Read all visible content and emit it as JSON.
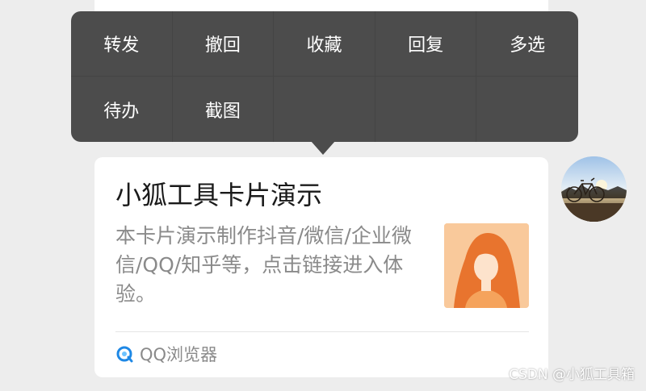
{
  "context_menu": {
    "items": [
      {
        "label": "转发"
      },
      {
        "label": "撤回"
      },
      {
        "label": "收藏"
      },
      {
        "label": "回复"
      },
      {
        "label": "多选"
      },
      {
        "label": "待办"
      },
      {
        "label": "截图"
      },
      {
        "label": ""
      },
      {
        "label": ""
      },
      {
        "label": ""
      }
    ]
  },
  "card": {
    "title": "小狐工具卡片演示",
    "description": "本卡片演示制作抖音/微信/企业微信/QQ/知乎等，点击链接进入体验。",
    "source": "QQ浏览器",
    "source_icon": "qq-browser-icon",
    "thumbnail_icon": "female-avatar-illustration"
  },
  "sender": {
    "avatar_icon": "bicycle-photo-avatar"
  },
  "watermark": "CSDN @小狐工具箱",
  "colors": {
    "menu_background": "#4c4c4c",
    "chat_background": "#ededed",
    "card_background": "#ffffff",
    "thumbnail_background": "#f9c99b",
    "hair_color": "#e8742e",
    "source_icon_color": "#1e88e5"
  }
}
